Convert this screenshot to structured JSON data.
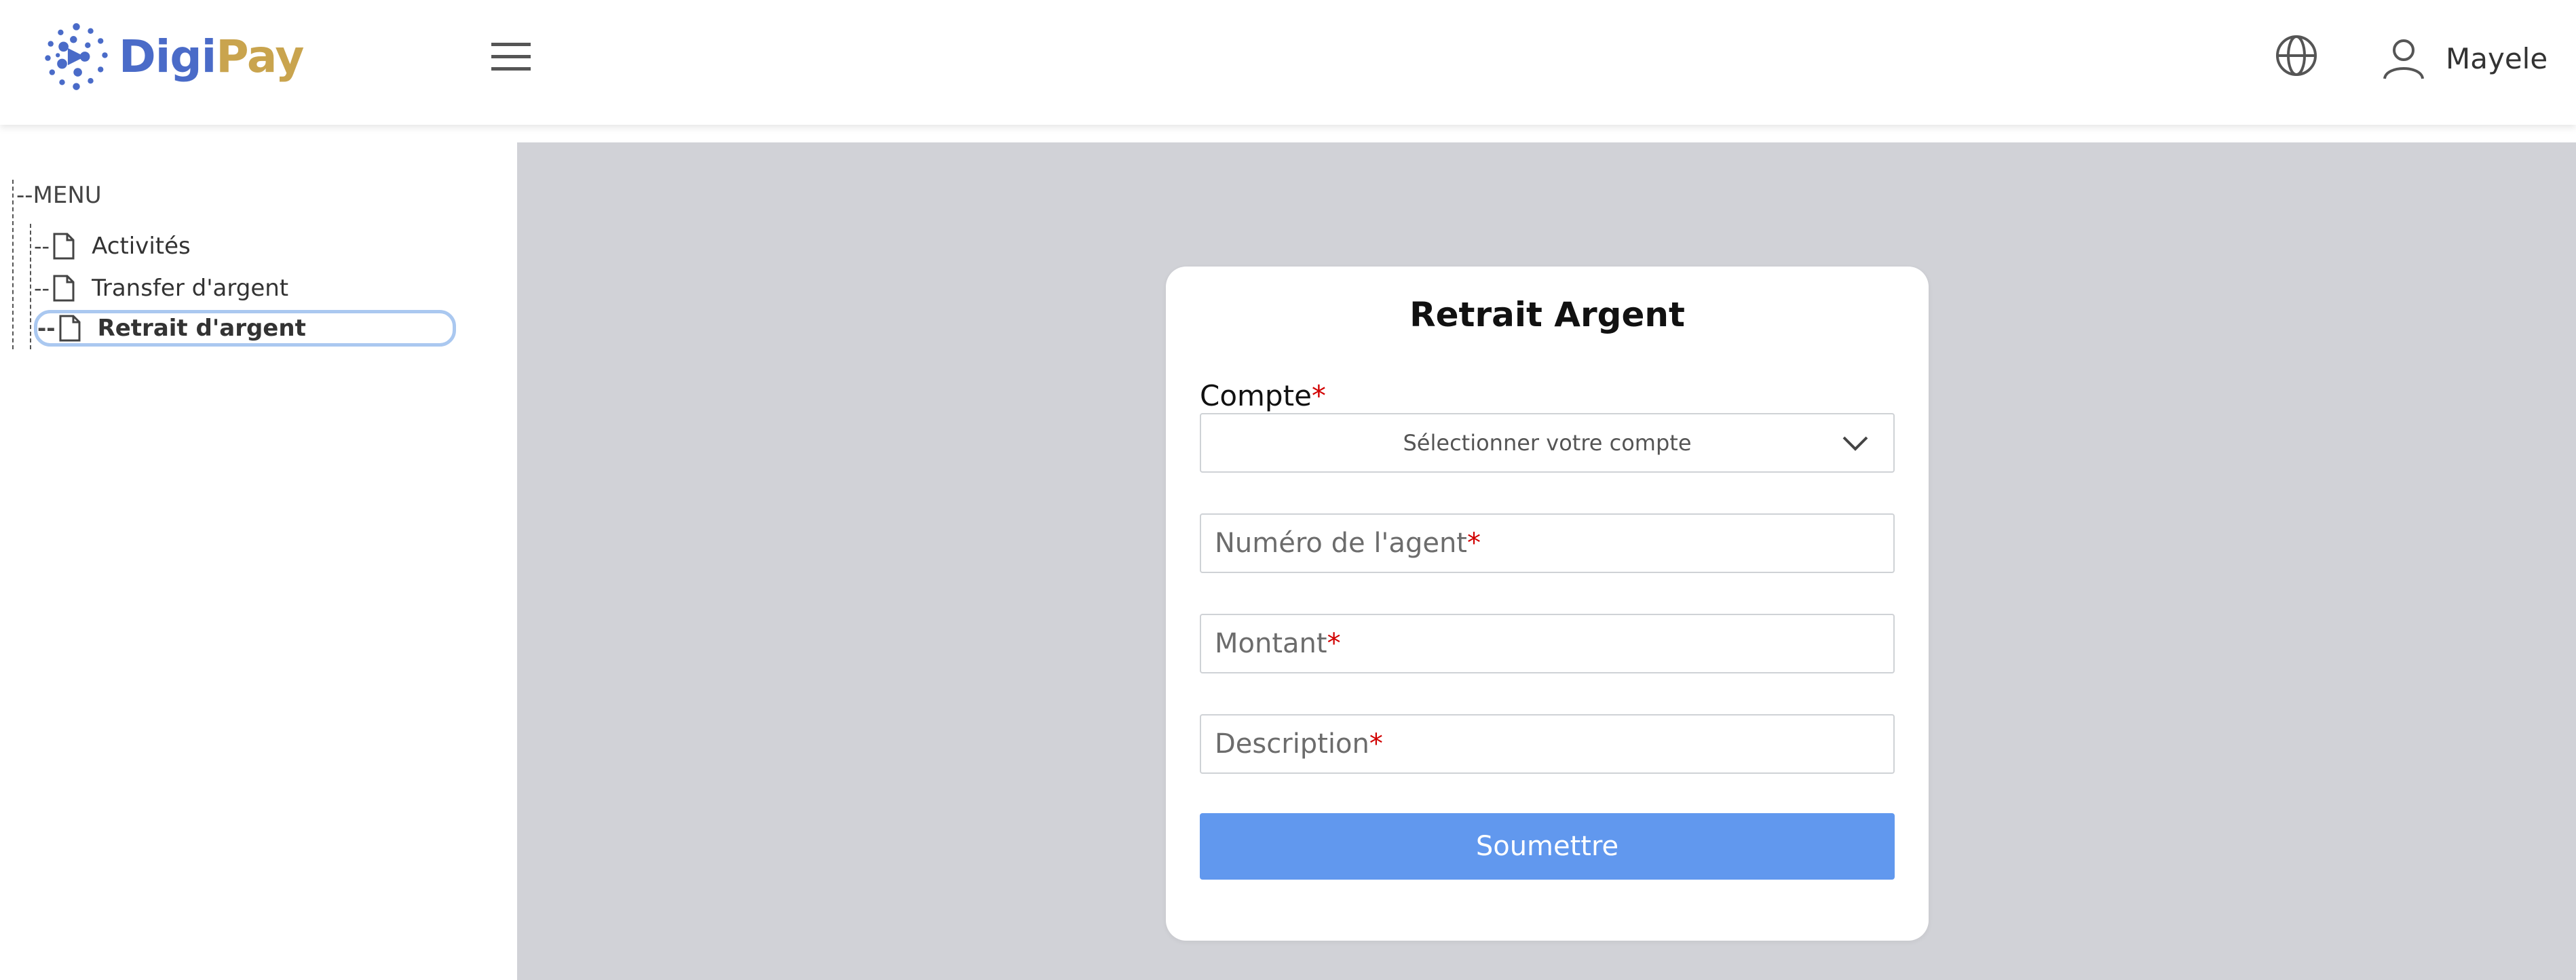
{
  "brand": {
    "name_part1": "Digi",
    "name_part2": "Pay",
    "colors": {
      "primary": "#4a6bc8",
      "accent": "#c9a44e"
    }
  },
  "header": {
    "menu_icon": "hamburger-icon",
    "language_icon": "globe-icon",
    "user_icon": "user-icon",
    "user_name": "Mayele"
  },
  "sidebar": {
    "menu_label": "--MENU",
    "items": [
      {
        "prefix": "--",
        "icon": "file-icon",
        "label": "Activités",
        "selected": false
      },
      {
        "prefix": "--",
        "icon": "file-icon",
        "label": "Transfer d'argent",
        "selected": false
      },
      {
        "prefix": "--",
        "icon": "file-icon",
        "label": "Retrait d'argent",
        "selected": true
      }
    ]
  },
  "form": {
    "title": "Retrait Argent",
    "account_label": "Compte",
    "required_marker": "*",
    "account_select_value": "Sélectionner votre compte",
    "agent_number_placeholder": "Numéro de l'agent",
    "amount_placeholder": "Montant",
    "description_placeholder": "Description",
    "submit_label": "Soumettre",
    "submit_color": "#6198ee"
  }
}
